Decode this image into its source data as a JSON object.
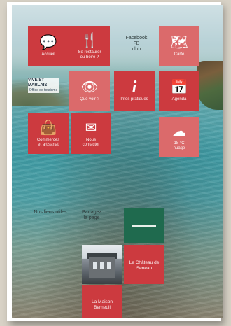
{
  "grid": {
    "tiles": [
      {
        "key": "t1",
        "label": "Accueil",
        "icon": "speech-bubble-icon",
        "glyph": "💬"
      },
      {
        "key": "t2",
        "label": "Se restaurer\nou boire ?",
        "icon": "fork-knife-icon",
        "glyph": "🍴"
      },
      {
        "key": "t3",
        "label": "Carte",
        "icon": "map-icon",
        "glyph": "🗺"
      },
      {
        "key": "t4",
        "label": "Que voir ?",
        "icon": "eye-icon",
        "glyph": "👁"
      },
      {
        "key": "t5",
        "label": "Infos pratiques",
        "icon": "info-icon",
        "glyph": "i"
      },
      {
        "key": "t6",
        "label": "Agenda",
        "icon": "calendar-icon",
        "glyph": "📅"
      },
      {
        "key": "t7",
        "label": "Commerces\net artisanat",
        "icon": "shopping-bag-icon",
        "glyph": "👜"
      },
      {
        "key": "t8",
        "label": "Nous\ncontacter",
        "icon": "envelope-icon",
        "glyph": "✉"
      },
      {
        "key": "t9",
        "label": "18 °C\nnuage",
        "icon": "weather-icon",
        "glyph": "☁"
      }
    ],
    "free_texts": [
      {
        "key": "f1",
        "text": "Facebook\nFB\nclub"
      },
      {
        "key": "f2",
        "text": "Nos liens utiles"
      },
      {
        "key": "f3",
        "text": "Partagez\nla page"
      }
    ],
    "logo": {
      "title": "VIVE ST MARLAIS",
      "subtitle": "Office de tourisme"
    },
    "bottom_tiles": [
      {
        "key": "b1",
        "label": "Le Château de\nSeneau"
      },
      {
        "key": "b2",
        "label": "La Maison\nBerneuil"
      }
    ]
  }
}
